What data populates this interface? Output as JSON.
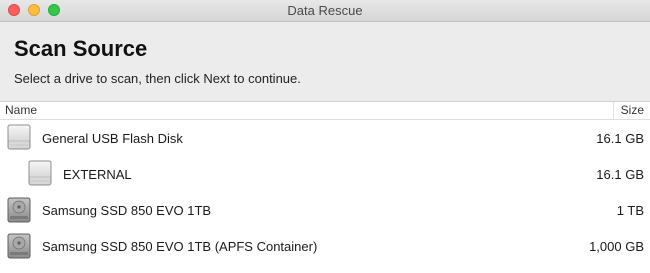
{
  "window": {
    "title": "Data Rescue"
  },
  "header": {
    "title": "Scan Source",
    "subtitle": "Select a drive to scan, then click Next to continue."
  },
  "table": {
    "columns": {
      "name": "Name",
      "size": "Size"
    },
    "rows": [
      {
        "name": "General USB Flash Disk",
        "size": "16.1 GB",
        "icon": "usb-drive-icon"
      },
      {
        "name": "EXTERNAL",
        "size": "16.1 GB",
        "icon": "volume-icon"
      },
      {
        "name": "Samsung SSD 850 EVO 1TB",
        "size": "1 TB",
        "icon": "internal-drive-icon"
      },
      {
        "name": "Samsung SSD 850 EVO 1TB (APFS Container)",
        "size": "1,000 GB",
        "icon": "internal-drive-icon"
      }
    ]
  },
  "colors": {
    "close": "#fc605c",
    "minimize": "#fdbc40",
    "maximize": "#34c84a"
  }
}
